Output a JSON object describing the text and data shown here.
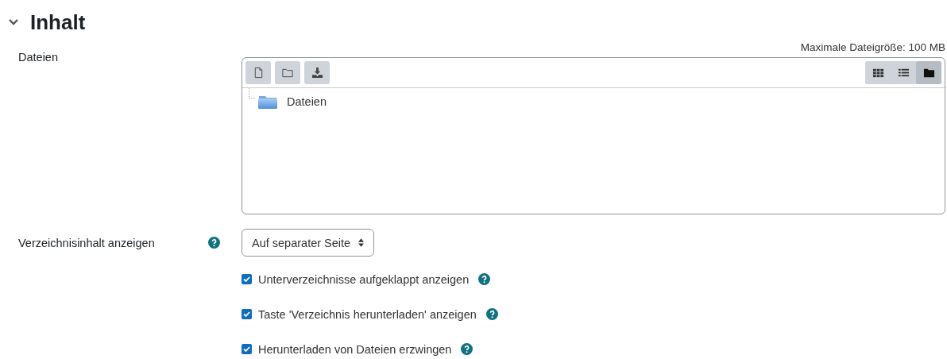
{
  "section": {
    "title": "Inhalt",
    "expanded": true
  },
  "files": {
    "label": "Dateien",
    "max_size": "Maximale Dateigröße: 100 MB",
    "toolbar": [
      {
        "kind": "file"
      },
      {
        "kind": "folder"
      },
      {
        "kind": "download"
      }
    ],
    "view_modes": [
      {
        "kind": "grid",
        "selected": false
      },
      {
        "kind": "list",
        "selected": false
      },
      {
        "kind": "tree",
        "selected": true
      }
    ],
    "tree": [
      {
        "label": "Dateien"
      }
    ]
  },
  "display": {
    "label": "Verzeichnisinhalt anzeigen",
    "value": "Auf separater Seite"
  },
  "options": [
    {
      "label": "Unterverzeichnisse aufgeklappt anzeigen",
      "checked": true
    },
    {
      "label": "Taste 'Verzeichnis herunterladen' anzeigen",
      "checked": true
    },
    {
      "label": "Herunterladen von Dateien erzwingen",
      "checked": true
    }
  ]
}
